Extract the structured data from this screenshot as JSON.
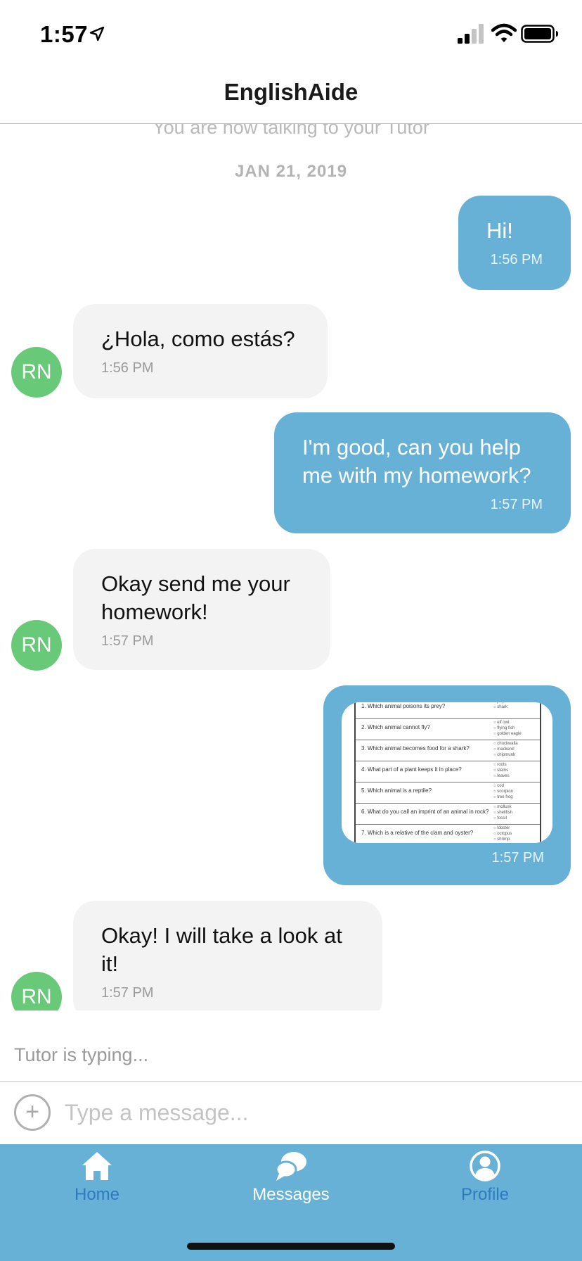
{
  "status_bar": {
    "time": "1:57",
    "icons": [
      "location-arrow-icon",
      "signal-icon",
      "wifi-icon",
      "battery-icon"
    ]
  },
  "header": {
    "title": "EnglishAide"
  },
  "chat": {
    "system_message": "You are now talking to your Tutor",
    "date": "JAN 21, 2019",
    "messages": [
      {
        "sender": "me",
        "text": "Hi!",
        "time": "1:56 PM"
      },
      {
        "sender": "tutor",
        "avatar": "RN",
        "text": "¿Hola, como estás?",
        "time": "1:56 PM"
      },
      {
        "sender": "me",
        "text": "I'm good, can you help me with my homework?",
        "time": "1:57 PM"
      },
      {
        "sender": "tutor",
        "avatar": "RN",
        "text": "Okay send me your homework!",
        "time": "1:57 PM"
      },
      {
        "sender": "me",
        "type": "image",
        "time": "1:57 PM",
        "worksheet": [
          {
            "q": "1. Which animal poisons its prey?",
            "opts": [
              "jellyfish",
              "shark"
            ]
          },
          {
            "q": "2. Which animal cannot fly?",
            "opts": [
              "elf owl",
              "flying fish",
              "golden eagle"
            ]
          },
          {
            "q": "3. Which animal becomes food for a shark?",
            "opts": [
              "chuckwalla",
              "mackerel",
              "chipmunk"
            ]
          },
          {
            "q": "4. What part of a plant keeps it in place?",
            "opts": [
              "roots",
              "stems",
              "leaves"
            ]
          },
          {
            "q": "5. Which animal is a reptile?",
            "opts": [
              "cod",
              "scorpion",
              "tree frog"
            ]
          },
          {
            "q": "6. What do you call an imprint of an animal in rock?",
            "opts": [
              "mollusk",
              "shellfish",
              "fossil"
            ]
          },
          {
            "q": "7. Which is a relative of the clam and oyster?",
            "opts": [
              "lobster",
              "octopus",
              "shrimp"
            ]
          }
        ]
      },
      {
        "sender": "tutor",
        "avatar": "RN",
        "text": "Okay! I will take a look at it!",
        "time": "1:57 PM"
      }
    ],
    "typing_indicator": "Tutor is typing..."
  },
  "composer": {
    "add_icon": "plus-circle-icon",
    "placeholder": "Type a message..."
  },
  "tabs": [
    {
      "label": "Home",
      "icon": "home-icon"
    },
    {
      "label": "Messages",
      "icon": "chat-bubbles-icon",
      "active": true
    },
    {
      "label": "Profile",
      "icon": "user-circle-icon"
    }
  ],
  "colors": {
    "accent": "#67b1d6",
    "avatar": "#68c978",
    "tab_inactive": "#2f79c2",
    "incoming_bubble": "#f3f3f3"
  }
}
